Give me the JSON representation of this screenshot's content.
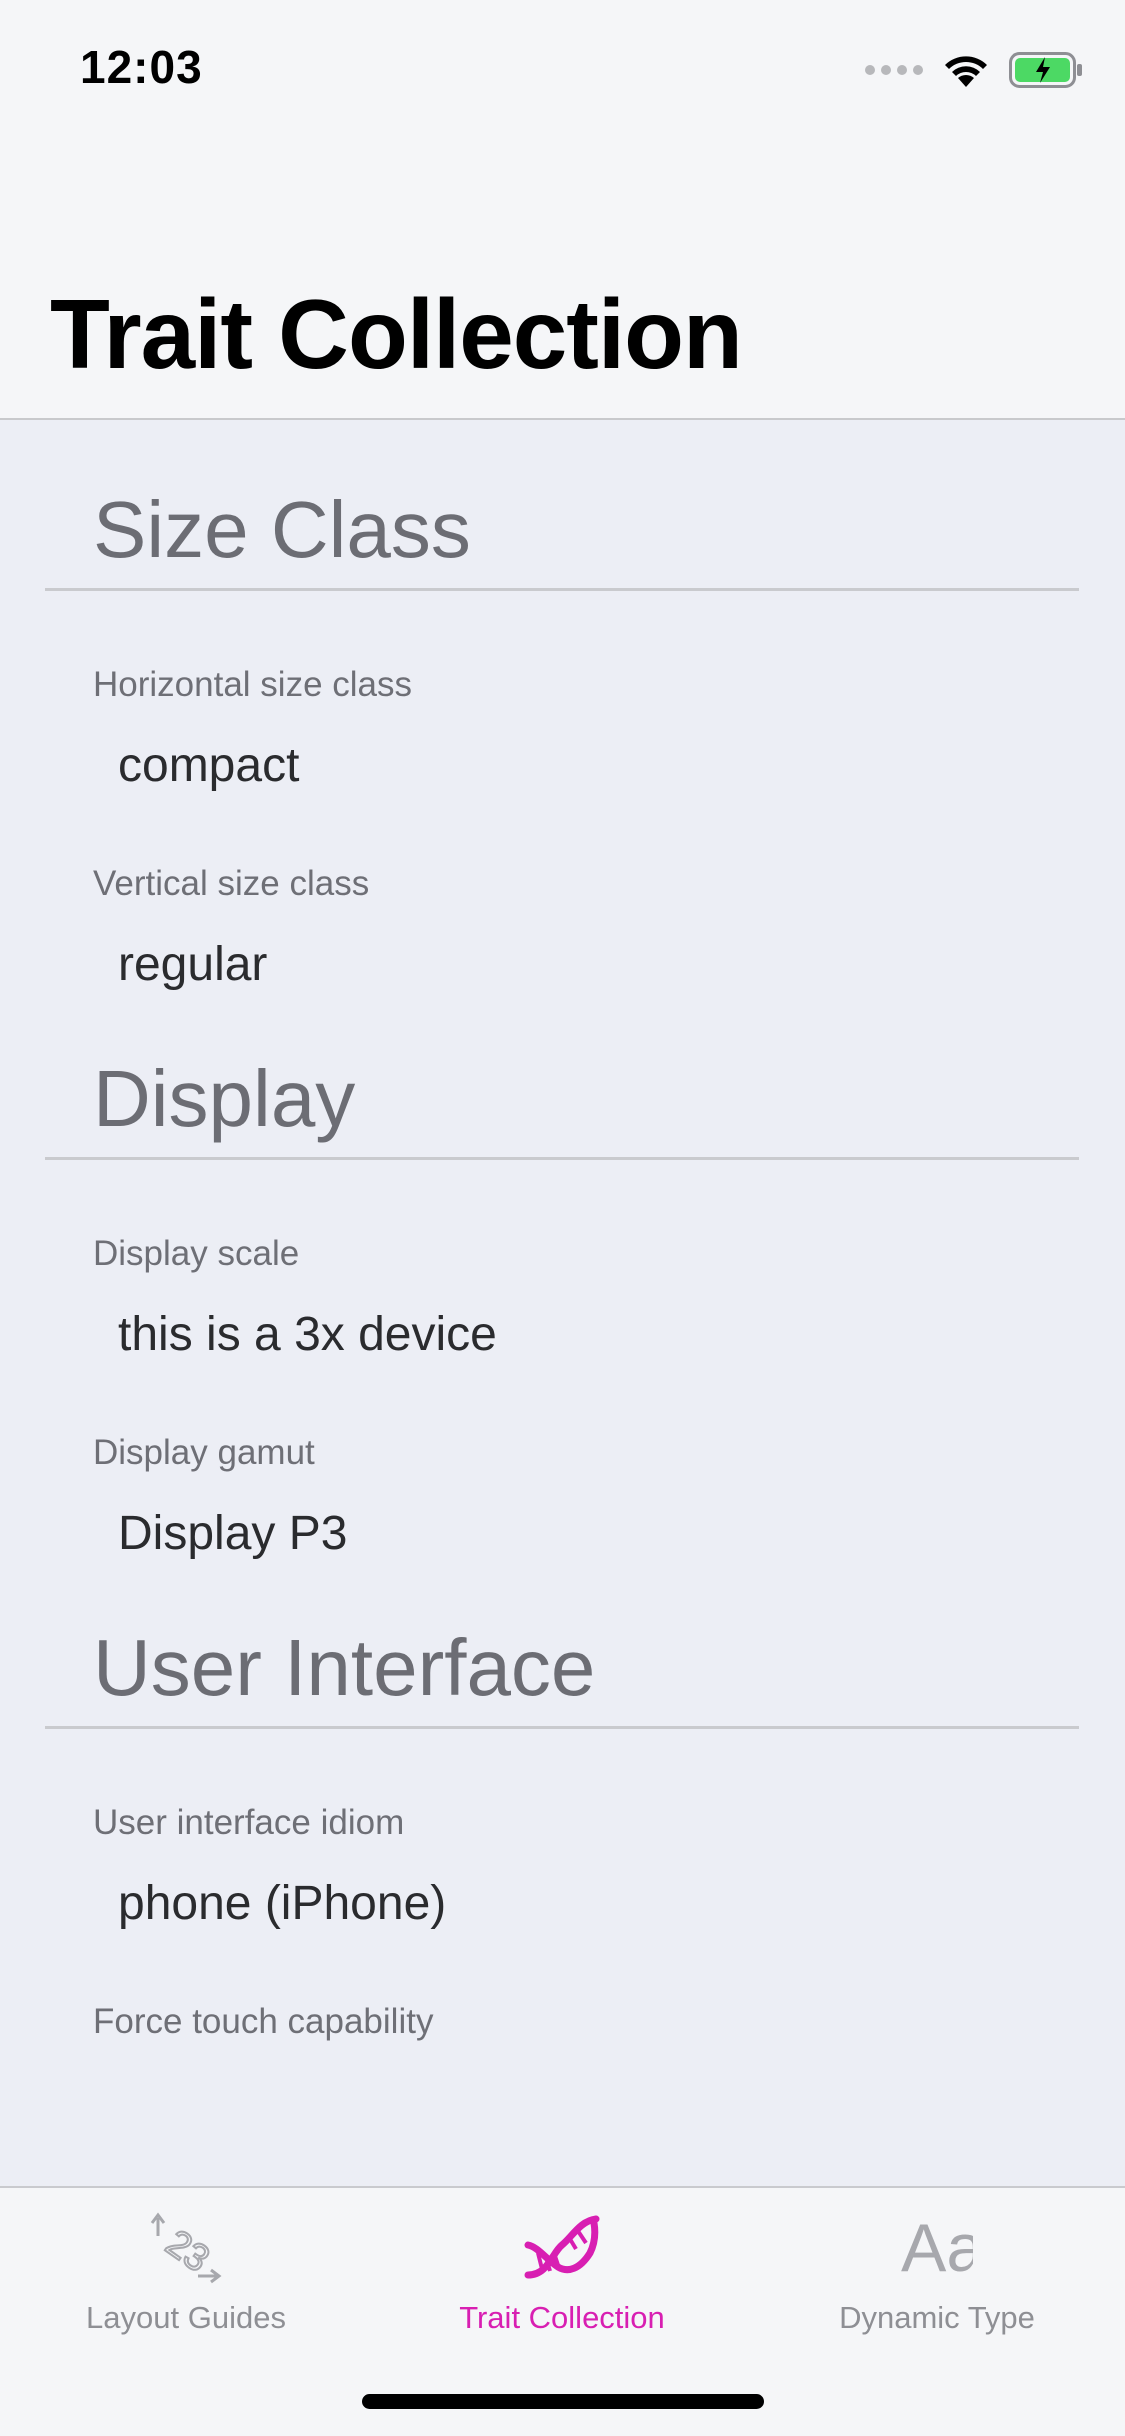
{
  "status_bar": {
    "time": "12:03",
    "icons": [
      "signal-icon",
      "wifi-icon",
      "battery-charging-icon"
    ]
  },
  "navigation": {
    "title": "Trait Collection"
  },
  "sections": [
    {
      "header": "Size Class",
      "rows": [
        {
          "label": "Horizontal size class",
          "value": "compact"
        },
        {
          "label": "Vertical size class",
          "value": "regular"
        }
      ]
    },
    {
      "header": "Display",
      "rows": [
        {
          "label": "Display scale",
          "value": "this is a 3x device"
        },
        {
          "label": "Display gamut",
          "value": "Display P3"
        }
      ]
    },
    {
      "header": "User Interface",
      "rows": [
        {
          "label": "User interface idiom",
          "value": "phone (iPhone)"
        },
        {
          "label": "Force touch capability",
          "value": ""
        }
      ]
    }
  ],
  "tab_bar": {
    "tabs": [
      {
        "label": "Layout Guides",
        "icon": "layout-guides-icon",
        "active": false
      },
      {
        "label": "Trait Collection",
        "icon": "dna-icon",
        "active": true
      },
      {
        "label": "Dynamic Type",
        "icon": "dynamic-type-icon",
        "icon_text": "Aa",
        "active": false
      }
    ]
  },
  "colors": {
    "accent": "#d81fb2",
    "background": "#eceef5",
    "bar_background": "#f5f6f8",
    "section_header": "#6c6d74",
    "battery_fill": "#4cd964"
  }
}
